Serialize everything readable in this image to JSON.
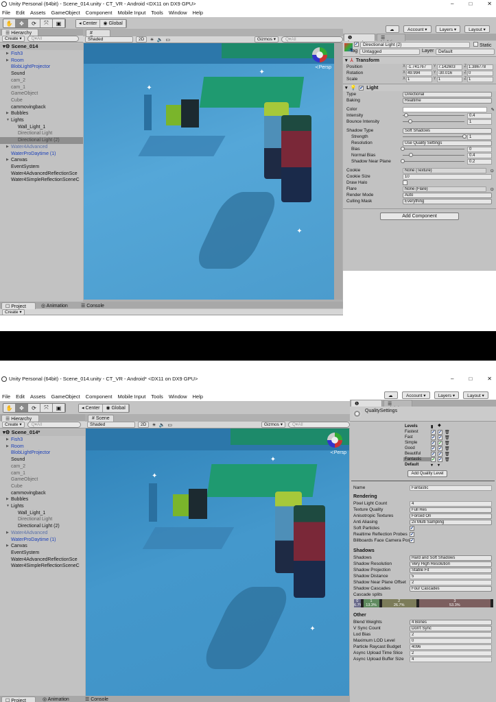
{
  "top": {
    "title": "Unity Personal (64bit) - Scene_014.unity - CT_VR - Android <DX11 on DX9 GPU>",
    "window_controls": [
      "–",
      "□",
      "✕"
    ],
    "menu": [
      "File",
      "Edit",
      "Assets",
      "GameObject",
      "Component",
      "Mobile Input",
      "Tools",
      "Window",
      "Help"
    ],
    "toolbar": {
      "tools": [
        "✋",
        "✥",
        "⟳",
        "⤧",
        "▣"
      ],
      "center": "◂ Center",
      "global": "◉ Global",
      "account": "Account ▾",
      "layers": "Layers ▾",
      "layout": "Layout ▾",
      "cloud": "☁"
    },
    "hierarchy": {
      "tab": "☰ Hierarchy",
      "create": "Create ▾",
      "search_placeholder": "Q▾All",
      "scene": "Scene_014",
      "items": [
        {
          "label": "Fish3",
          "style": "blue",
          "arrow": true,
          "indent": 0
        },
        {
          "label": "Room",
          "style": "blue",
          "arrow": true,
          "indent": 0
        },
        {
          "label": "BlobLightProjector",
          "style": "blue",
          "arrow": false,
          "indent": 0
        },
        {
          "label": "Sound",
          "style": "",
          "arrow": false,
          "indent": 0
        },
        {
          "label": "cam_2",
          "style": "grey",
          "arrow": false,
          "indent": 0
        },
        {
          "label": "cam_1",
          "style": "grey",
          "arrow": false,
          "indent": 0
        },
        {
          "label": "GameObject",
          "style": "grey",
          "arrow": false,
          "indent": 0
        },
        {
          "label": "Cube",
          "style": "grey",
          "arrow": false,
          "indent": 0
        },
        {
          "label": "cammovingback",
          "style": "",
          "arrow": false,
          "indent": 0
        },
        {
          "label": "Bubbles",
          "style": "",
          "arrow": true,
          "indent": 0
        },
        {
          "label": "Lights",
          "style": "",
          "arrow": true,
          "indent": 0
        },
        {
          "label": "Wall_Light_1",
          "style": "",
          "arrow": false,
          "indent": 1
        },
        {
          "label": "Directional Light",
          "style": "grey",
          "arrow": false,
          "indent": 1
        },
        {
          "label": "Directional Light (2)",
          "style": "sel",
          "arrow": false,
          "indent": 1
        },
        {
          "label": "Water4Advanced",
          "style": "bgrey",
          "arrow": true,
          "indent": 0
        },
        {
          "label": "WaterProDaytime (1)",
          "style": "blue",
          "arrow": false,
          "indent": 0
        },
        {
          "label": "Canvas",
          "style": "",
          "arrow": true,
          "indent": 0
        },
        {
          "label": "EventSystem",
          "style": "",
          "arrow": false,
          "indent": 0
        },
        {
          "label": "Water4AdvancedReflectionSce",
          "style": "",
          "arrow": false,
          "indent": 0
        },
        {
          "label": "Water4SimpleReflectionSceneC",
          "style": "",
          "arrow": false,
          "indent": 0
        }
      ]
    },
    "scene": {
      "tab": "# Scene",
      "shading": "Shaded",
      "mode_2d": "2D",
      "gizmos": "Gizmos ▾",
      "search_placeholder": "Q▾All",
      "persp": "≺Persp"
    },
    "inspector": {
      "tabs": [
        "❶ Inspector",
        "☰ Lighting"
      ],
      "object_name": "Directional Light (2)",
      "static_label": "Static",
      "tag_label": "Tag",
      "tag_value": "Untagged",
      "layer_label": "Layer",
      "layer_value": "Default",
      "transform": {
        "title": "Transform",
        "rows": [
          {
            "label": "Position",
            "x": "-1.741767",
            "y": "7.142603",
            "z": "1.386778"
          },
          {
            "label": "Rotation",
            "x": "49.994",
            "y": "-30.016",
            "z": "0"
          },
          {
            "label": "Scale",
            "x": "1",
            "y": "1",
            "z": "1"
          }
        ]
      },
      "light": {
        "title": "Light",
        "rows": [
          {
            "label": "Type",
            "kind": "dd",
            "value": "Directional"
          },
          {
            "label": "Baking",
            "kind": "dd",
            "value": "Realtime"
          },
          {
            "label": "",
            "kind": "gap"
          },
          {
            "label": "Color",
            "kind": "color",
            "value": ""
          },
          {
            "label": "Intensity",
            "kind": "slider",
            "value": "0.4",
            "fraction": 0.05
          },
          {
            "label": "Bounce Intensity",
            "kind": "slider",
            "value": "1",
            "fraction": 0.125
          },
          {
            "label": "",
            "kind": "gap"
          },
          {
            "label": "Shadow Type",
            "kind": "dd",
            "value": "Soft Shadows"
          },
          {
            "label": "Strength",
            "kind": "slider",
            "value": "1",
            "fraction": 1,
            "indent": true
          },
          {
            "label": "Resolution",
            "kind": "dd",
            "value": "Use Quality Settings",
            "indent": true
          },
          {
            "label": "Bias",
            "kind": "slider",
            "value": "0",
            "fraction": 0,
            "indent": true
          },
          {
            "label": "Normal Bias",
            "kind": "slider",
            "value": "0.4",
            "fraction": 0.13,
            "indent": true
          },
          {
            "label": "Shadow Near Plane",
            "kind": "slider",
            "value": "0.2",
            "fraction": 0,
            "indent": true
          },
          {
            "label": "",
            "kind": "gap"
          },
          {
            "label": "Cookie",
            "kind": "obj",
            "value": "None (Texture)"
          },
          {
            "label": "Cookie Size",
            "kind": "field",
            "value": "10"
          },
          {
            "label": "Draw Halo",
            "kind": "cb",
            "value": ""
          },
          {
            "label": "Flare",
            "kind": "obj",
            "value": "None (Flare)"
          },
          {
            "label": "Render Mode",
            "kind": "dd",
            "value": "Auto"
          },
          {
            "label": "Culling Mask",
            "kind": "dd",
            "value": "Everything"
          }
        ]
      },
      "add_component": "Add Component"
    },
    "bottom_tabs": [
      "☐ Project",
      "◎ Animation",
      "☰ Console"
    ],
    "bottom_create": "Create ▾"
  },
  "bottom": {
    "title": "Unity Personal (64bit) - Scene_014.unity - CT_VR - Android* <DX11 on DX9 GPU>",
    "window_controls": [
      "–",
      "□",
      "✕"
    ],
    "menu": [
      "File",
      "Edit",
      "Assets",
      "GameObject",
      "Component",
      "Mobile Input",
      "Tools",
      "Window",
      "Help"
    ],
    "toolbar": {
      "tools": [
        "✋",
        "✥",
        "⟳",
        "⤧",
        "▣"
      ],
      "center": "◂ Center",
      "global": "◉ Global",
      "account": "Account ▾",
      "layers": "Layers ▾",
      "layout": "Layout ▾",
      "cloud": "☁"
    },
    "hierarchy": {
      "tab": "☰ Hierarchy",
      "create": "Create ▾",
      "search_placeholder": "Q▾All",
      "scene": "Scene_014*",
      "items": [
        {
          "label": "Fish3",
          "style": "blue",
          "arrow": true,
          "indent": 0
        },
        {
          "label": "Room",
          "style": "blue",
          "arrow": true,
          "indent": 0
        },
        {
          "label": "BlobLightProjector",
          "style": "blue",
          "arrow": false,
          "indent": 0
        },
        {
          "label": "Sound",
          "style": "",
          "arrow": false,
          "indent": 0
        },
        {
          "label": "cam_2",
          "style": "grey",
          "arrow": false,
          "indent": 0
        },
        {
          "label": "cam_1",
          "style": "grey",
          "arrow": false,
          "indent": 0
        },
        {
          "label": "GameObject",
          "style": "grey",
          "arrow": false,
          "indent": 0
        },
        {
          "label": "Cube",
          "style": "grey",
          "arrow": false,
          "indent": 0
        },
        {
          "label": "cammovingback",
          "style": "",
          "arrow": false,
          "indent": 0
        },
        {
          "label": "Bubbles",
          "style": "",
          "arrow": true,
          "indent": 0
        },
        {
          "label": "Lights",
          "style": "",
          "arrow": true,
          "indent": 0
        },
        {
          "label": "Wall_Light_1",
          "style": "",
          "arrow": false,
          "indent": 1
        },
        {
          "label": "Directional Light",
          "style": "grey",
          "arrow": false,
          "indent": 1
        },
        {
          "label": "Directional Light (2)",
          "style": "",
          "arrow": false,
          "indent": 1
        },
        {
          "label": "Water4Advanced",
          "style": "bgrey",
          "arrow": true,
          "indent": 0
        },
        {
          "label": "WaterProDaytime (1)",
          "style": "blue",
          "arrow": false,
          "indent": 0
        },
        {
          "label": "Canvas",
          "style": "",
          "arrow": true,
          "indent": 0
        },
        {
          "label": "EventSystem",
          "style": "",
          "arrow": false,
          "indent": 0
        },
        {
          "label": "Water4AdvancedReflectionSce",
          "style": "",
          "arrow": false,
          "indent": 0
        },
        {
          "label": "Water4SimpleReflectionSceneC",
          "style": "",
          "arrow": false,
          "indent": 0
        }
      ]
    },
    "scene": {
      "tab": "# Scene",
      "shading": "Shaded",
      "mode_2d": "2D",
      "gizmos": "Gizmos ▾",
      "search_placeholder": "Q▾All",
      "persp": "≺Persp"
    },
    "inspector": {
      "tabs": [
        "❶ Inspector",
        "☰ Lighting"
      ],
      "object_name": "QualitySettings",
      "levels": {
        "title": "Levels",
        "default_label": "Default",
        "add_button": "Add Quality Level",
        "rows": [
          {
            "name": "Fastest",
            "c1": "✔",
            "c2": "✔",
            "c1green": false,
            "c2green": false,
            "selected": false
          },
          {
            "name": "Fast",
            "c1": "✔",
            "c2": "✔",
            "c1green": false,
            "c2green": false,
            "selected": false
          },
          {
            "name": "Simple",
            "c1": "✔",
            "c2": "✔",
            "c1green": false,
            "c2green": true,
            "selected": false
          },
          {
            "name": "Good",
            "c1": "✔",
            "c2": "✔",
            "c1green": false,
            "c2green": false,
            "selected": false
          },
          {
            "name": "Beautiful",
            "c1": "✔",
            "c2": "✔",
            "c1green": false,
            "c2green": false,
            "selected": false
          },
          {
            "name": "Fantastic",
            "c1": "✔",
            "c2": "✔",
            "c1green": true,
            "c2green": false,
            "selected": true
          }
        ]
      },
      "name_label": "Name",
      "name_value": "Fantastic",
      "rendering": {
        "title": "Rendering",
        "rows": [
          {
            "label": "Pixel Light Count",
            "kind": "field",
            "value": "4"
          },
          {
            "label": "Texture Quality",
            "kind": "dd",
            "value": "Full Res"
          },
          {
            "label": "Anisotropic Textures",
            "kind": "dd",
            "value": "Forced On"
          },
          {
            "label": "Anti Aliasing",
            "kind": "dd",
            "value": "2x Multi Sampling"
          },
          {
            "label": "Soft Particles",
            "kind": "cb",
            "value": "✔"
          },
          {
            "label": "Realtime Reflection Probes",
            "kind": "cb",
            "value": "✔"
          },
          {
            "label": "Billboards Face Camera Pos",
            "kind": "cb",
            "value": "✔"
          }
        ]
      },
      "shadows": {
        "title": "Shadows",
        "rows": [
          {
            "label": "Shadows",
            "kind": "dd",
            "value": "Hard and Soft Shadows"
          },
          {
            "label": "Shadow Resolution",
            "kind": "dd",
            "value": "Very High Resolution"
          },
          {
            "label": "Shadow Projection",
            "kind": "dd",
            "value": "Stable Fit"
          },
          {
            "label": "Shadow Distance",
            "kind": "field",
            "value": "5"
          },
          {
            "label": "Shadow Near Plane Offset",
            "kind": "field",
            "value": "2"
          },
          {
            "label": "Shadow Cascades",
            "kind": "dd",
            "value": "Four Cascades"
          }
        ],
        "cascade_label": "Cascade splits",
        "cascades": [
          {
            "index": "0",
            "percent": "6.7%",
            "share": 6.7,
            "color": "#6a6a8a"
          },
          {
            "index": "1",
            "percent": "13.3%",
            "share": 13.3,
            "color": "#5f8a5f"
          },
          {
            "index": "2",
            "percent": "26.7%",
            "share": 26.7,
            "color": "#7c7c5a"
          },
          {
            "index": "3",
            "percent": "53.3%",
            "share": 53.3,
            "color": "#7c5f5f"
          }
        ]
      },
      "other": {
        "title": "Other",
        "rows": [
          {
            "label": "Blend Weights",
            "kind": "dd",
            "value": "4 Bones"
          },
          {
            "label": "V Sync Count",
            "kind": "dd",
            "value": "Don't Sync"
          },
          {
            "label": "Lod Bias",
            "kind": "field",
            "value": "2"
          },
          {
            "label": "Maximum LOD Level",
            "kind": "field",
            "value": "0"
          },
          {
            "label": "Particle Raycast Budget",
            "kind": "field",
            "value": "4096"
          },
          {
            "label": "Async Upload Time Slice",
            "kind": "field",
            "value": "2"
          },
          {
            "label": "Async Upload Buffer Size",
            "kind": "field",
            "value": "4"
          }
        ]
      }
    },
    "bottom_tabs": [
      "☐ Project",
      "◎ Animation",
      "☰ Console"
    ]
  }
}
